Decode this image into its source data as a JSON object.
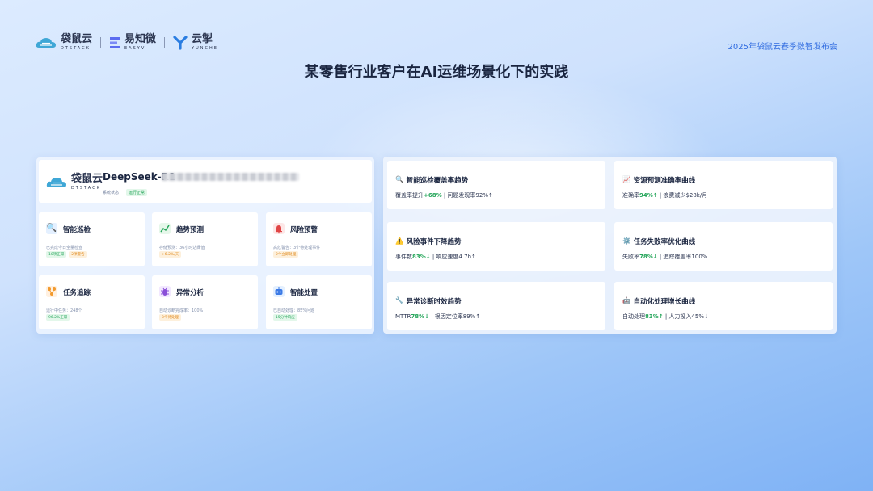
{
  "header": {
    "logos": [
      {
        "name": "袋鼠云",
        "sub": "DTSTACK"
      },
      {
        "name": "易知微",
        "sub": "EASYV"
      },
      {
        "name": "云掣",
        "sub": "YUNCHE"
      }
    ],
    "event": "2025年袋鼠云春季数智发布会",
    "title": "某零售行业客户在AI运维场景化下的实践"
  },
  "left_panel": {
    "brand": {
      "name": "袋鼠云",
      "sub": "DTSTACK"
    },
    "model": "DeepSeek-R1",
    "status_label": "系统状态",
    "status_badge": "运行正常",
    "features": [
      {
        "name": "智能巡检",
        "desc": "已完成今日全量检查",
        "tags": [
          {
            "text": "10项正常",
            "type": "g"
          },
          {
            "text": "2项警告",
            "type": "o"
          }
        ],
        "icon": "search-icon"
      },
      {
        "name": "趋势预测",
        "desc": "存储预测：36小时达阈值",
        "tags": [
          {
            "text": "+6.2%/天",
            "type": "o"
          }
        ],
        "icon": "chart-icon"
      },
      {
        "name": "风险预警",
        "desc": "高危警告：3个待处理事件",
        "tags": [
          {
            "text": "2个立即处理",
            "type": "o"
          }
        ],
        "icon": "bell-icon"
      },
      {
        "name": "任务追踪",
        "desc": "运行中任务：248个",
        "tags": [
          {
            "text": "96.2%正常",
            "type": "g"
          }
        ],
        "icon": "flow-icon"
      },
      {
        "name": "异常分析",
        "desc": "自动诊断完成率：100%",
        "tags": [
          {
            "text": "3个待处理",
            "type": "o"
          }
        ],
        "icon": "bug-icon"
      },
      {
        "name": "智能处置",
        "desc": "已自动处理：85%问题",
        "tags": [
          {
            "text": "15分钟响应",
            "type": "g"
          }
        ],
        "icon": "robot-icon"
      }
    ]
  },
  "metrics": [
    {
      "icon": "🔍",
      "title": "智能巡检覆盖率趋势",
      "pre": "覆盖率提升",
      "hl": "+68%",
      "post": " | 问题发现率92%↑"
    },
    {
      "icon": "📈",
      "title": "资源预测准确率曲线",
      "pre": "准确率",
      "hl": "94%↑",
      "post": " | 浪费减少$28k/月"
    },
    {
      "icon": "⚠️",
      "title": "风险事件下降趋势",
      "pre": "事件数",
      "hl": "83%↓",
      "post": " | 响应速度4.7h↑"
    },
    {
      "icon": "⚙️",
      "title": "任务失败率优化曲线",
      "pre": "失败率",
      "hl": "78%↓",
      "post": " | 追踪覆盖率100%"
    },
    {
      "icon": "🔧",
      "title": "异常诊断时效趋势",
      "pre": "MTTR",
      "hl": "78%↓",
      "post": " | 根因定位率89%↑"
    },
    {
      "icon": "🤖",
      "title": "自动化处理增长曲线",
      "pre": "自动处理",
      "hl": "83%↑",
      "post": " | 人力投入45%↓"
    }
  ],
  "colors": {
    "accent": "#2f6be0",
    "positive": "#26a65b",
    "warning": "#e08a1e"
  }
}
